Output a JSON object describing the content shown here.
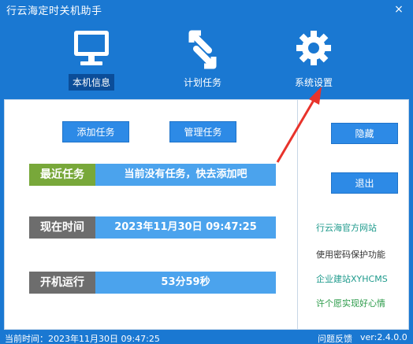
{
  "window": {
    "title": "行云海定时关机助手"
  },
  "nav": [
    {
      "label": "本机信息",
      "icon": "monitor-icon"
    },
    {
      "label": "计划任务",
      "icon": "arrows-icon"
    },
    {
      "label": "系统设置",
      "icon": "gear-icon"
    }
  ],
  "buttons": {
    "add_task": "添加任务",
    "manage_task": "管理任务",
    "hide": "隐藏",
    "exit": "退出"
  },
  "rows": [
    {
      "tag": "最近任务",
      "value": "当前没有任务，快去添加吧",
      "tag_color": "#78a83a"
    },
    {
      "tag": "现在时间",
      "value": "2023年11月30日  09:47:25",
      "tag_color": "#6d6d6d"
    },
    {
      "tag": "开机运行",
      "value": "53分59秒",
      "tag_color": "#6d6d6d"
    }
  ],
  "links": [
    {
      "text": "行云海官方网站",
      "color": "#1e9a8c"
    },
    {
      "text": "使用密码保护功能",
      "color": "#333333"
    },
    {
      "text": "企业建站XYHCMS",
      "color": "#1e9a8c"
    },
    {
      "text": "许个愿实现好心情",
      "color": "#2a9a48"
    }
  ],
  "status": {
    "time": "当前时间：2023年11月30日  09:47:25",
    "feedback": "问题反馈",
    "version": "ver:2.4.0.0"
  },
  "colors": {
    "window": "#1a78d2",
    "button": "#2d8ae6",
    "annotation_arrow": "#e8332b"
  }
}
